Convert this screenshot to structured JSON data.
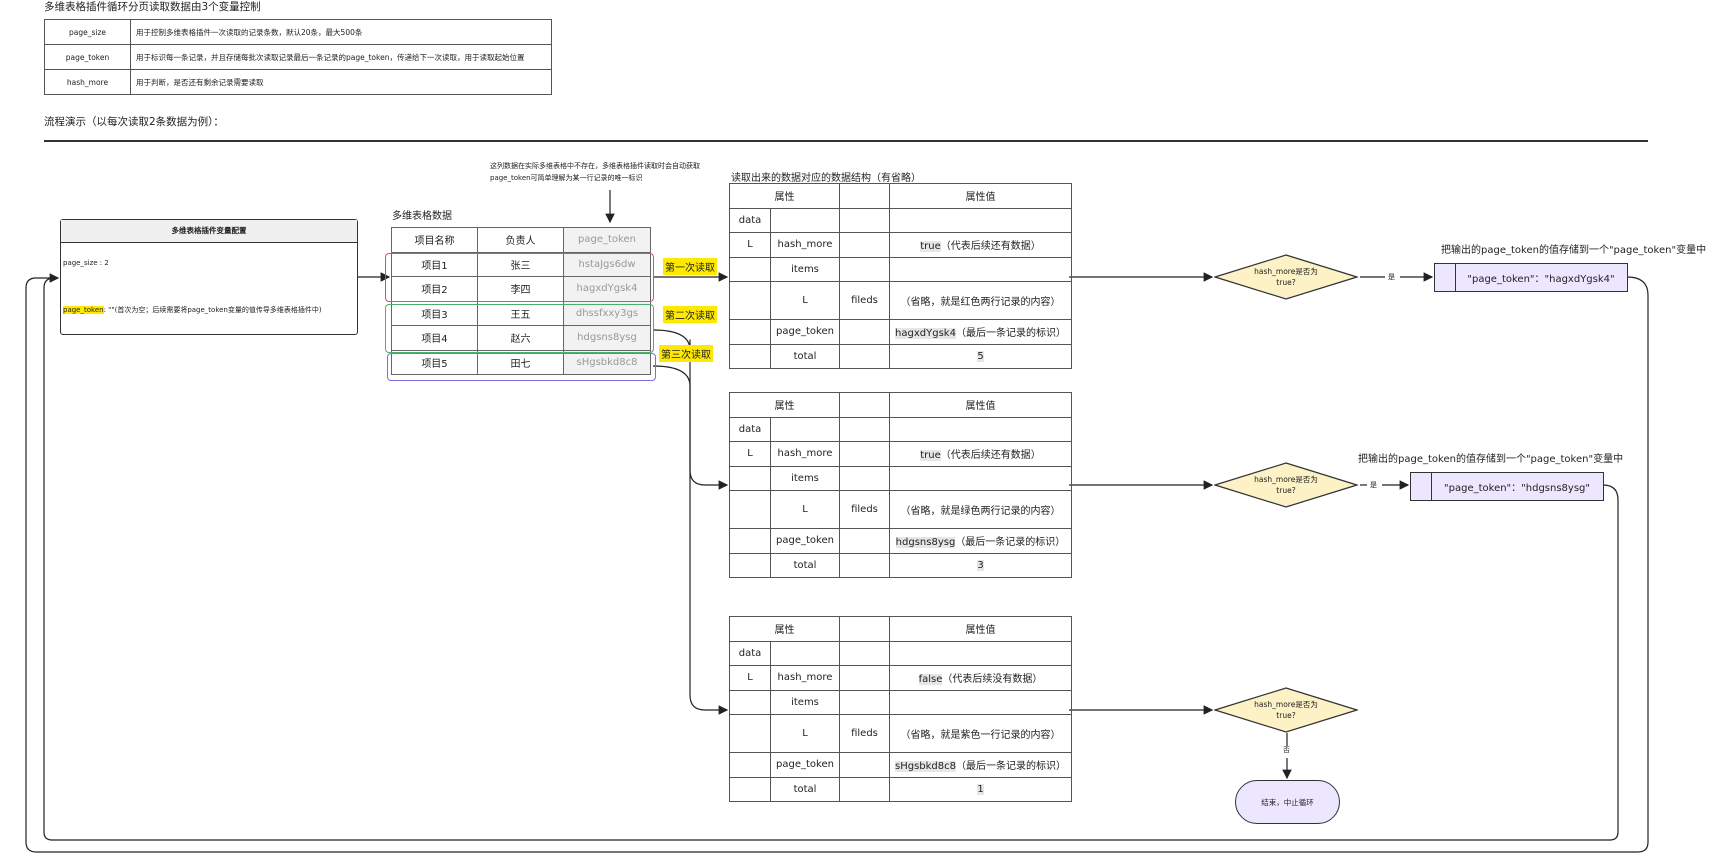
{
  "header": {
    "title": "多维表格插件循环分页读取数据由3个变量控制",
    "flow_title": "流程演示（以每次读取2条数据为例）："
  },
  "variables": [
    {
      "key": "page_size",
      "desc": "用于控制多维表格插件一次读取的记录条数，默认20条，最大500条"
    },
    {
      "key": "page_token",
      "desc": "用于标识每一条记录，并且存储每批次读取记录最后一条记录的page_token，传递给下一次读取，用于读取起始位置"
    },
    {
      "key": "hash_more",
      "desc": "用于判断，是否还有剩余记录需要读取"
    }
  ],
  "config": {
    "title": "多维表格插件变量配置",
    "page_size": "page_size : 2",
    "page_token_key": "page_token",
    "page_token_desc": ": \"\"(首次为空；后续需要将page_token变量的值传导多维表格插件中)"
  },
  "note": {
    "line1": "这列数据在实际多维表格中不存在，多维表格插件读取时会自动获取",
    "line2": "page_token可简单理解为某一行记录的唯一标识"
  },
  "data_table": {
    "label": "多维表格数据",
    "headers": [
      "项目名称",
      "负责人",
      "page_token"
    ],
    "rows": [
      [
        "项目1",
        "张三",
        "hstaJgs6dw"
      ],
      [
        "项目2",
        "李四",
        "hagxdYgsk4"
      ],
      [
        "项目3",
        "王五",
        "dhssfxxy3gs"
      ],
      [
        "项目4",
        "赵六",
        "hdgsns8ysg"
      ],
      [
        "项目5",
        "田七",
        "sHgsbkd8c8"
      ]
    ]
  },
  "reads": {
    "first": "第一次读取",
    "second": "第二次读取",
    "third": "第三次读取"
  },
  "structure": {
    "caption": "读取出来的数据对应的数据结构（有省略）",
    "head_attr": "属性",
    "head_val": "属性值",
    "data": "data",
    "L": "L",
    "hash_more": "hash_more",
    "items": "items",
    "fileds": "fileds",
    "page_token": "page_token",
    "total": "total",
    "tables": [
      {
        "hm_val": "true",
        "hm_note": "（代表后续还有数据）",
        "fields_note": "（省略，就是红色两行记录的内容）",
        "pt_val": "hagxdYgsk4",
        "pt_note": "（最后一条记录的标识）",
        "total": "5"
      },
      {
        "hm_val": "true",
        "hm_note": "（代表后续还有数据）",
        "fields_note": "（省略，就是绿色两行记录的内容）",
        "pt_val": "hdgsns8ysg",
        "pt_note": "（最后一条记录的标识）",
        "total": "3"
      },
      {
        "hm_val": "false",
        "hm_note": "（代表后续没有数据）",
        "fields_note": "（省略，就是紫色一行记录的内容）",
        "pt_val": "sHgsbkd8c8",
        "pt_note": "（最后一条记录的标识）",
        "total": "1"
      }
    ]
  },
  "decisions": {
    "question_line1": "hash_more是否为",
    "question_line2": "true?",
    "yes": "是",
    "no": "否"
  },
  "store": {
    "caption1": "把输出的page_token的值存储到一个\"page_token\"变量中",
    "value1": "\"page_token\"：\"hagxdYgsk4\"",
    "caption2": "把输出的page_token的值存储到一个\"page_token\"变量中",
    "value2": "\"page_token\"：\"hdgsns8ysg\""
  },
  "end": {
    "label": "结束，中止循环"
  },
  "colors": {
    "first_read": "#e05252",
    "second_read": "#4caf6e",
    "third_read": "#7a70d8",
    "highlight": "#ffe900",
    "decision_fill": "#fdf1c6",
    "terminal_fill": "#ece6ff"
  }
}
